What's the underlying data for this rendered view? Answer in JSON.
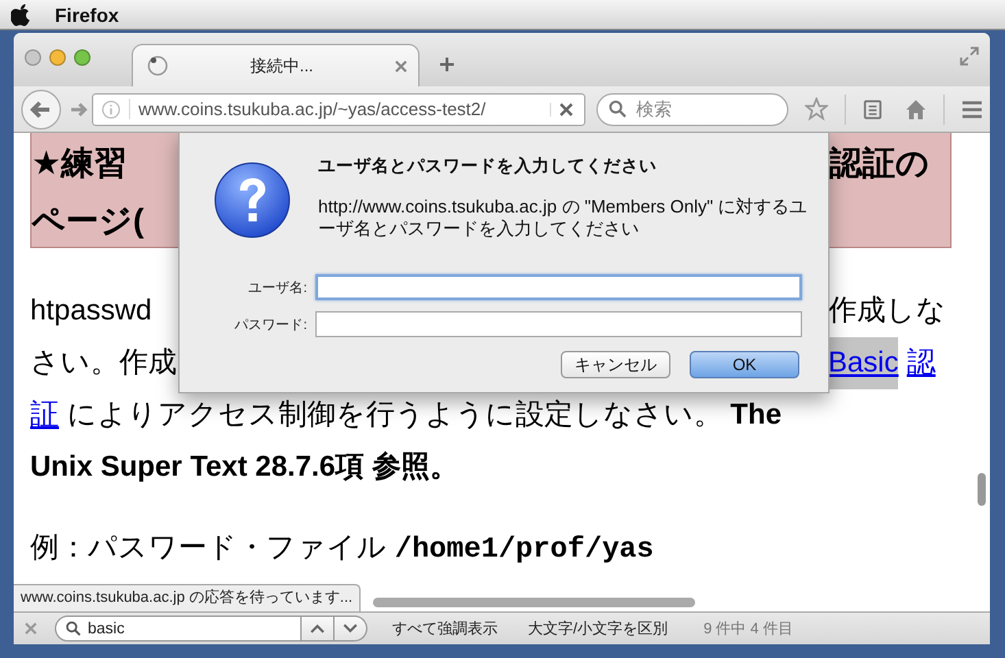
{
  "menu_bar": {
    "app_name": "Firefox"
  },
  "tabs": [
    {
      "title": "接続中...",
      "selected": true,
      "loading": true
    }
  ],
  "toolbar": {
    "url": "www.coins.tsukuba.ac.jp/~yas/access-test2/",
    "search": {
      "placeholder": "検索"
    }
  },
  "page": {
    "heading_lines": [
      {
        "left": "★練習",
        "right": "認証の"
      },
      {
        "left": "ページ("
      }
    ],
    "paragraphs": [
      {
        "lines": [
          {
            "kind": "split",
            "left": [
              {
                "text": "htpasswd",
                "kind": "plain"
              }
            ],
            "right": [
              {
                "text": "作成しな",
                "kind": "plain"
              }
            ]
          },
          {
            "kind": "split",
            "left": [
              {
                "text": "さい。作成",
                "kind": "plain"
              }
            ],
            "right": [
              {
                "text": "Basic",
                "kind": "link",
                "highlighted": true
              },
              {
                "text": "認",
                "kind": "link",
                "highlighted": false
              }
            ]
          },
          {
            "kind": "full",
            "segments": [
              {
                "text": "証",
                "kind": "link",
                "highlighted": false
              },
              {
                "text": " によりアクセス制御を行うように設定しなさい。 ",
                "kind": "plain"
              },
              {
                "text": "The",
                "kind": "bold"
              }
            ]
          },
          {
            "kind": "full",
            "segments": [
              {
                "text": "Unix Super Text 28.7.6項 参照。",
                "kind": "bold"
              }
            ]
          }
        ]
      },
      {
        "lines": [
          {
            "kind": "full",
            "segments": [
              {
                "text": "例：パスワード・ファイル ",
                "kind": "plain"
              },
              {
                "text": "/home1/prof/yas",
                "kind": "mono"
              }
            ]
          }
        ]
      }
    ]
  },
  "dialog": {
    "title": "ユーザ名とパスワードを入力してください",
    "message": "http://www.coins.tsukuba.ac.jp の \"Members Only\" に対するユーザ名とパスワードを入力してください",
    "fields": [
      {
        "label": "ユーザ名:",
        "focused": true
      },
      {
        "label": "パスワード:",
        "focused": false
      }
    ],
    "buttons": [
      {
        "label": "キャンセル",
        "default": false
      },
      {
        "label": "OK",
        "default": true
      }
    ]
  },
  "status_tooltip": "www.coins.tsukuba.ac.jp の応答を待っています...",
  "find_bar": {
    "query": "basic",
    "highlight_all": "すべて強調表示",
    "match_case": "大文字/小文字を区別",
    "result": "9 件中 4 件目"
  }
}
